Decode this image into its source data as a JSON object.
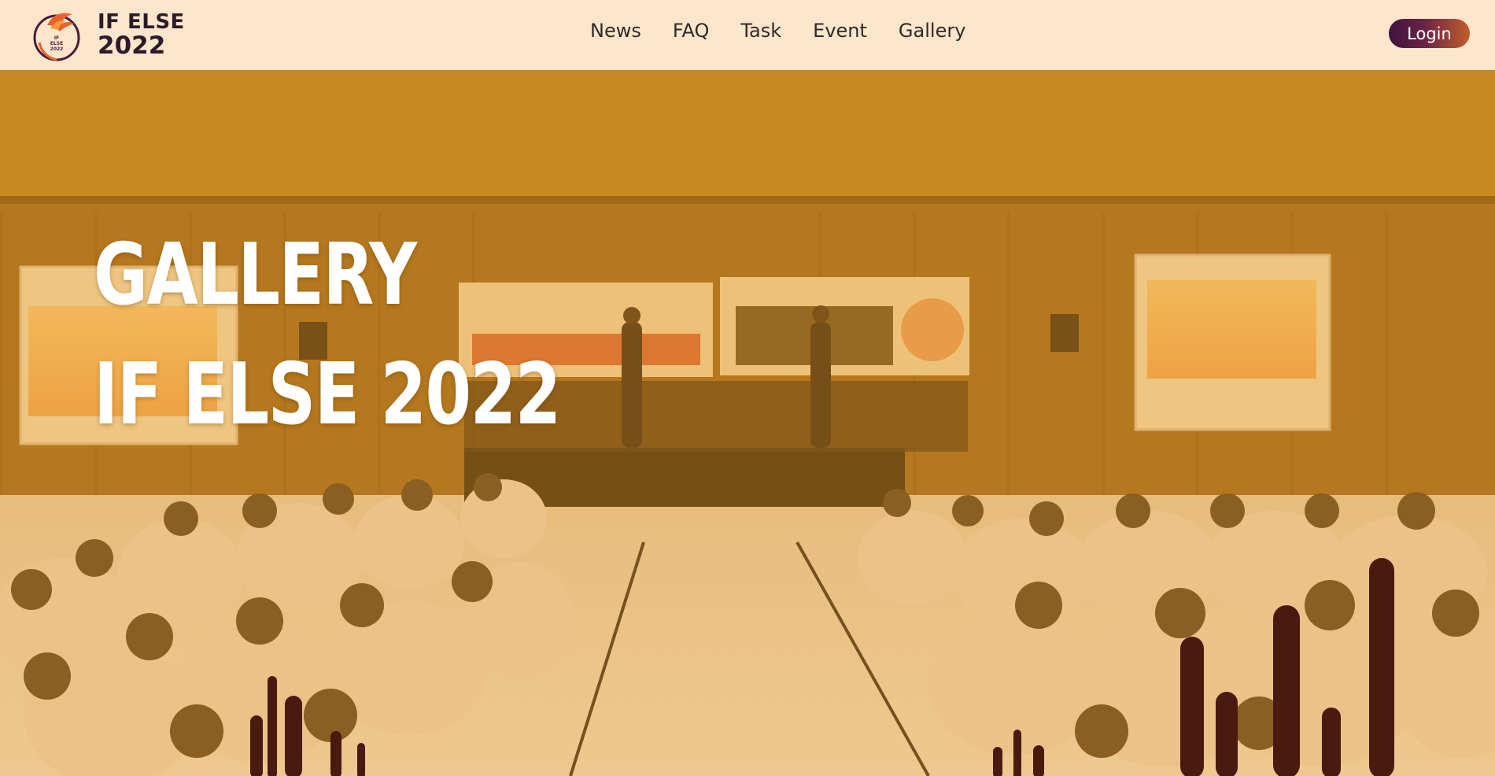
{
  "brand": {
    "line1": "IF ELSE",
    "line2": "2022",
    "logo_text": [
      "IF",
      "ELSE",
      "2022"
    ]
  },
  "nav": {
    "items": [
      {
        "label": "News"
      },
      {
        "label": "FAQ"
      },
      {
        "label": "Task"
      },
      {
        "label": "Event"
      },
      {
        "label": "Gallery"
      }
    ]
  },
  "login": {
    "label": "Login"
  },
  "hero": {
    "title_line1": "GALLERY",
    "title_line2": "IF ELSE 2022"
  },
  "colors": {
    "header_bg": "#fde6cb",
    "overlay_tint": "#e8a33a",
    "text_dark": "#2e1a2a",
    "login_gradient_start": "#3f1340",
    "login_gradient_end": "#c15e2c",
    "cactus": "#4a1a10"
  },
  "icons": {
    "logo": "phoenix-logo-icon",
    "decor": "cactus-silhouette-icon"
  }
}
